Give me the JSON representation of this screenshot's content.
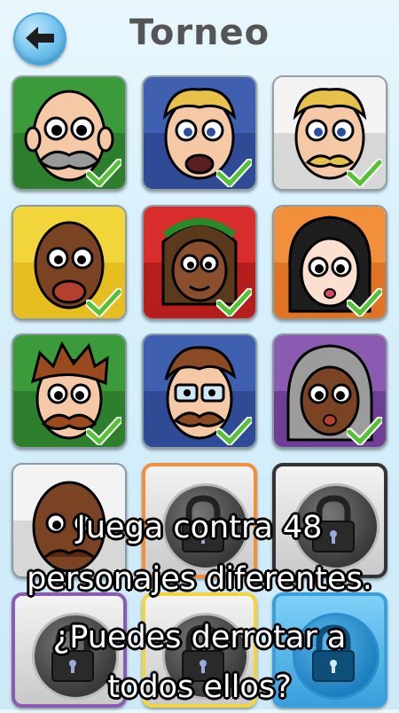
{
  "header": {
    "title": "Torneo",
    "back_icon": "back-arrow-icon"
  },
  "caption": {
    "line1": "Juega contra 48",
    "line2": "personajes diferentes.",
    "line3": "¿Puedes derrotar a",
    "line4": "todos ellos?"
  },
  "tiles": [
    {
      "status": "defeated",
      "top": "#3b9b3b",
      "bottom": "#2d7f2d"
    },
    {
      "status": "defeated",
      "top": "#3f5fb0",
      "bottom": "#2f4b95"
    },
    {
      "status": "defeated",
      "top": "#f3f3f3",
      "bottom": "#d7d7d7"
    },
    {
      "status": "defeated",
      "top": "#f2d53a",
      "bottom": "#e6be1f"
    },
    {
      "status": "defeated",
      "top": "#d92c2c",
      "bottom": "#b61e1e"
    },
    {
      "status": "defeated",
      "top": "#f28f3a",
      "bottom": "#e07425"
    },
    {
      "status": "defeated",
      "top": "#3b9b3b",
      "bottom": "#2d7f2d"
    },
    {
      "status": "defeated",
      "top": "#3f5fb0",
      "bottom": "#2f4b95"
    },
    {
      "status": "defeated",
      "top": "#8a5bb0",
      "bottom": "#6d4096"
    },
    {
      "status": "available",
      "top": "#f3f3f3",
      "bottom": "#d7d7d7"
    },
    {
      "status": "locked",
      "frame": "#f28f3a"
    },
    {
      "status": "locked",
      "frame": "#333333"
    },
    {
      "status": "locked",
      "frame": "#8a5bb0"
    },
    {
      "status": "locked",
      "frame": "#f2d53a"
    },
    {
      "status": "locked",
      "frame": "#3aa0dc"
    }
  ],
  "colors": {
    "check": "#55c236",
    "accent": "#3a9fdc"
  }
}
